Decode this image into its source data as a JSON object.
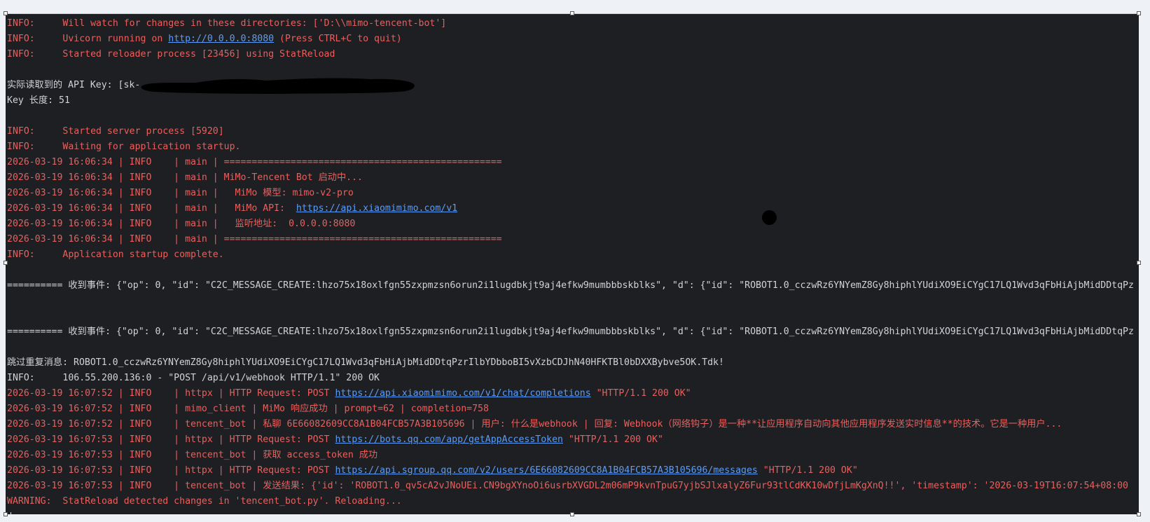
{
  "colors": {
    "log_red": "#e8605e",
    "log_plain": "#d1d3d8",
    "link": "#5b9cf6",
    "terminal_bg": "#1e1f22",
    "page_bg": "#eef1f6"
  },
  "terminal": {
    "lines": [
      {
        "segs": [
          {
            "t": "INFO:     Will watch for changes in these directories: ['D:\\\\mimo-tencent-bot']",
            "c": "red"
          }
        ]
      },
      {
        "segs": [
          {
            "t": "INFO:     Uvicorn running on ",
            "c": "red"
          },
          {
            "t": "http://0.0.0.0:8080",
            "c": "link"
          },
          {
            "t": " (Press CTRL+C to quit)",
            "c": "red"
          }
        ]
      },
      {
        "segs": [
          {
            "t": "INFO:     Started reloader process [23456] using StatReload",
            "c": "red"
          }
        ]
      },
      {
        "segs": []
      },
      {
        "segs": [
          {
            "t": "实际读取到的 API Key: [sk-",
            "c": "plain"
          },
          {
            "c": "redaction"
          }
        ]
      },
      {
        "segs": [
          {
            "t": "Key 长度: 51",
            "c": "plain"
          }
        ]
      },
      {
        "segs": []
      },
      {
        "segs": [
          {
            "t": "INFO:     Started server process [5920]",
            "c": "red"
          }
        ]
      },
      {
        "segs": [
          {
            "t": "INFO:     Waiting for application startup.",
            "c": "red"
          }
        ]
      },
      {
        "segs": [
          {
            "t": "2026-03-19 16:06:34 | INFO    | main | ==================================================",
            "c": "red"
          }
        ]
      },
      {
        "segs": [
          {
            "t": "2026-03-19 16:06:34 | INFO    | main | MiMo-Tencent Bot 启动中...",
            "c": "red"
          }
        ]
      },
      {
        "segs": [
          {
            "t": "2026-03-19 16:06:34 | INFO    | main |   MiMo 模型: mimo-v2-pro",
            "c": "red"
          }
        ]
      },
      {
        "segs": [
          {
            "t": "2026-03-19 16:06:34 | INFO    | main |   MiMo API:  ",
            "c": "red"
          },
          {
            "t": "https://api.xiaomimimo.com/v1",
            "c": "link"
          }
        ]
      },
      {
        "segs": [
          {
            "t": "2026-03-19 16:06:34 | INFO    | main |   监听地址:  0.0.0.0:8080",
            "c": "red"
          }
        ]
      },
      {
        "segs": [
          {
            "t": "2026-03-19 16:06:34 | INFO    | main | ==================================================",
            "c": "red"
          }
        ]
      },
      {
        "segs": [
          {
            "t": "INFO:     Application startup complete.",
            "c": "red"
          }
        ]
      },
      {
        "segs": []
      },
      {
        "segs": [
          {
            "t": "========== 收到事件: {\"op\": 0, \"id\": \"C2C_MESSAGE_CREATE:lhzo75x18oxlfgn55zxpmzsn6orun2i1lugdbkjt9aj4efkw9mumbbbskblks\", \"d\": {\"id\": \"ROBOT1.0_cczwRz6YNYemZ8Gy8hiphlYUdiXO9EiCYgC17LQ1Wvd3qFbHiAjbMidDDtqPz",
            "c": "plain"
          }
        ]
      },
      {
        "segs": []
      },
      {
        "segs": []
      },
      {
        "segs": [
          {
            "t": "========== 收到事件: {\"op\": 0, \"id\": \"C2C_MESSAGE_CREATE:lhzo75x18oxlfgn55zxpmzsn6orun2i1lugdbkjt9aj4efkw9mumbbbskblks\", \"d\": {\"id\": \"ROBOT1.0_cczwRz6YNYemZ8Gy8hiphlYUdiXO9EiCYgC17LQ1Wvd3qFbHiAjbMidDDtqPz",
            "c": "plain"
          }
        ]
      },
      {
        "segs": []
      },
      {
        "segs": [
          {
            "t": "跳过重复消息: ROBOT1.0_cczwRz6YNYemZ8Gy8hiphlYUdiXO9EiCYgC17LQ1Wvd3qFbHiAjbMidDDtqPzrIlbYDbboBI5vXzbCDJhN40HFKTBl0bDXXBybve5OK.Tdk!",
            "c": "plain"
          }
        ]
      },
      {
        "segs": [
          {
            "t": "INFO:     106.55.200.136:0 - \"POST /api/v1/webhook HTTP/1.1\" 200 OK",
            "c": "plain"
          }
        ]
      },
      {
        "segs": [
          {
            "t": "2026-03-19 16:07:52 | INFO    | httpx | HTTP Request: POST ",
            "c": "red"
          },
          {
            "t": "https://api.xiaomimimo.com/v1/chat/completions",
            "c": "link"
          },
          {
            "t": " \"HTTP/1.1 200 OK\"",
            "c": "red"
          }
        ]
      },
      {
        "segs": [
          {
            "t": "2026-03-19 16:07:52 | INFO    | mimo_client | MiMo 响应成功 | prompt=62 | completion=758",
            "c": "red"
          }
        ]
      },
      {
        "segs": [
          {
            "t": "2026-03-19 16:07:52 | INFO    | tencent_bot | 私聊 6E66082609CC8A1B04FCB57A3B105696 | 用户: 什么是webhook | 回复: Webhook（网络钩子）是一种**让应用程序自动向其他应用程序发送实时信息**的技术。它是一种用户...",
            "c": "red"
          }
        ]
      },
      {
        "segs": [
          {
            "t": "2026-03-19 16:07:53 | INFO    | httpx | HTTP Request: POST ",
            "c": "red"
          },
          {
            "t": "https://bots.qq.com/app/getAppAccessToken",
            "c": "link"
          },
          {
            "t": " \"HTTP/1.1 200 OK\"",
            "c": "red"
          }
        ]
      },
      {
        "segs": [
          {
            "t": "2026-03-19 16:07:53 | INFO    | tencent_bot | 获取 access_token 成功",
            "c": "red"
          }
        ]
      },
      {
        "segs": [
          {
            "t": "2026-03-19 16:07:53 | INFO    | httpx | HTTP Request: POST ",
            "c": "red"
          },
          {
            "t": "https://api.sgroup.qq.com/v2/users/6E66082609CC8A1B04FCB57A3B105696/messages",
            "c": "link"
          },
          {
            "t": " \"HTTP/1.1 200 OK\"",
            "c": "red"
          }
        ]
      },
      {
        "segs": [
          {
            "t": "2026-03-19 16:07:53 | INFO    | tencent_bot | 发送结果: {'id': 'ROBOT1.0_qv5cA2vJNoUEi.CN9bgXYnoOi6usrbXVGDL2m06mP9kvnTpuG7yjbSJlxalyZ6Fur93tlCdKK10wDfjLmKgXnQ!!', 'timestamp': '2026-03-19T16:07:54+08:00",
            "c": "red"
          }
        ]
      },
      {
        "segs": [
          {
            "t": "WARNING:  StatReload detected changes in 'tencent_bot.py'. Reloading...",
            "c": "red"
          }
        ]
      },
      {
        "segs": [
          {
            "c": "cursor"
          }
        ]
      }
    ]
  }
}
